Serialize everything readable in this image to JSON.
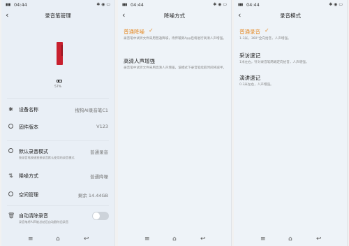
{
  "status": {
    "time": "04:44",
    "signal": "4G",
    "battery": "86"
  },
  "panel1": {
    "title": "录音笔管理",
    "battery_pct": "57%",
    "rows": {
      "device_name": {
        "label": "设备名称",
        "value": "搜狗AI录音笔C1"
      },
      "firmware": {
        "label": "固件版本",
        "value": "V123"
      },
      "default_mode": {
        "label": "默认录音模式",
        "value": "普通录音",
        "sub": "按录音笔按键直接录音默认使用的录音模式"
      },
      "noise": {
        "label": "降噪方式",
        "value": "普通降噪"
      },
      "storage": {
        "label": "空间管理",
        "value": "剩余 14.44GB"
      },
      "auto_clear": {
        "label": "自动清除录音",
        "sub": "录音笔将AI声能总结后自动删除旧录音"
      }
    }
  },
  "panel2": {
    "title": "降噪方式",
    "options": [
      {
        "title": "普通降噪",
        "desc": "录音笔中试听文件采用普通降噪，待传输到App后将进行高清人声增强。",
        "selected": true
      },
      {
        "title": "高清人声增强",
        "desc": "录音笔中试听文件采用高清人声增强，该模式下录音笔续航时间将减半。",
        "selected": false
      }
    ]
  },
  "panel3": {
    "title": "录音模式",
    "options": [
      {
        "title": "普通录音",
        "desc": "1-3米，360°全向拾音，人声增强。",
        "selected": true
      },
      {
        "title": "采访速记",
        "desc": "1米左右，针对录音笔两端定向拾音，人声增强。",
        "selected": false
      },
      {
        "title": "演讲速记",
        "desc": "0.3米左右，人声增强。",
        "selected": false
      }
    ]
  },
  "icons": {
    "back": "back-arrow-icon",
    "bluetooth": "bluetooth-icon",
    "firmware": "firmware-icon",
    "mode": "mic-mode-icon",
    "noise": "noise-icon",
    "storage": "storage-icon",
    "trash": "trash-icon",
    "check": "check-icon"
  },
  "colors": {
    "accent": "#e58c2a",
    "pen": "#c8202e",
    "bg": "#e9eff6"
  }
}
